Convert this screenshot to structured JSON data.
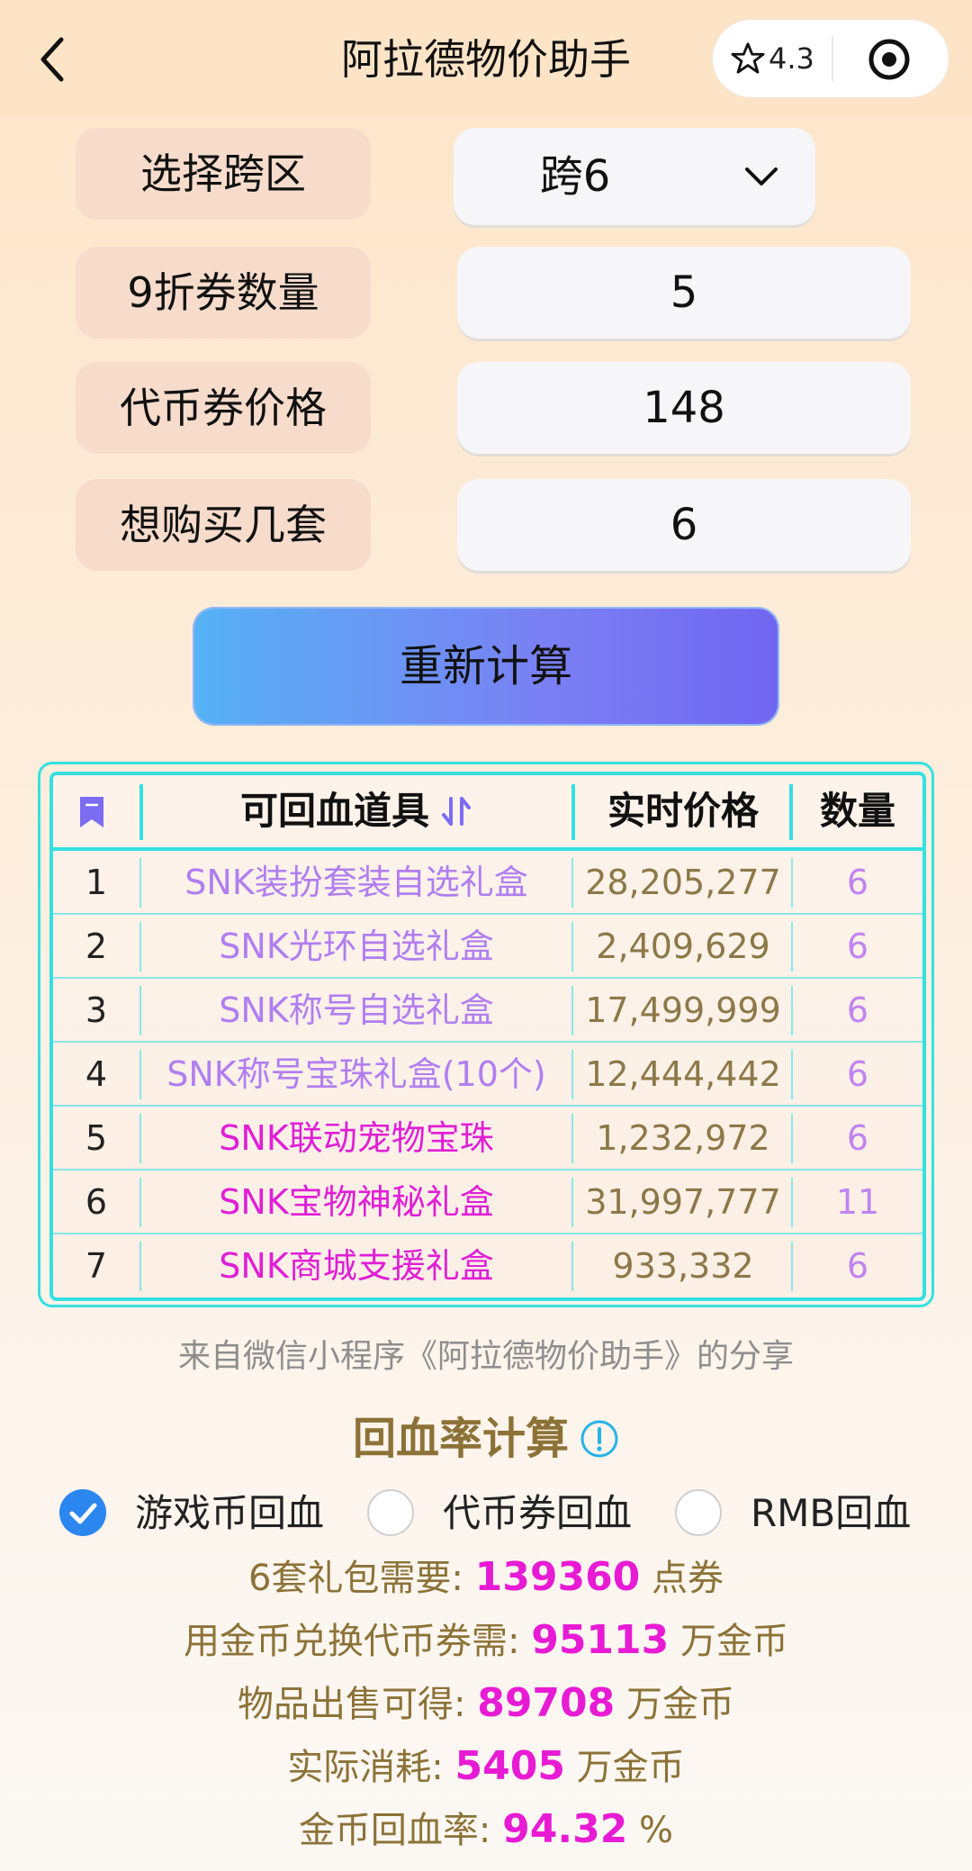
{
  "header": {
    "title": "阿拉德物价助手",
    "rating": "4.3"
  },
  "form": {
    "region_label": "选择跨区",
    "region_value": "跨6",
    "coupon_label": "9折券数量",
    "coupon_value": "5",
    "token_price_label": "代币券价格",
    "token_price_value": "148",
    "sets_label": "想购买几套",
    "sets_value": "6",
    "recalc_button": "重新计算"
  },
  "table": {
    "headers": {
      "item": "可回血道具",
      "price": "实时价格",
      "qty": "数量"
    },
    "rows": [
      {
        "idx": "1",
        "name": "SNK装扮套装自选礼盒",
        "price": "28,205,277",
        "qty": "6",
        "name_color": "#b07ef0"
      },
      {
        "idx": "2",
        "name": "SNK光环自选礼盒",
        "price": "2,409,629",
        "qty": "6",
        "name_color": "#b07ef0"
      },
      {
        "idx": "3",
        "name": "SNK称号自选礼盒",
        "price": "17,499,999",
        "qty": "6",
        "name_color": "#b07ef0"
      },
      {
        "idx": "4",
        "name": "SNK称号宝珠礼盒(10个)",
        "price": "12,444,442",
        "qty": "6",
        "name_color": "#b07ef0"
      },
      {
        "idx": "5",
        "name": "SNK联动宠物宝珠",
        "price": "1,232,972",
        "qty": "6",
        "name_color": "#e01fd6"
      },
      {
        "idx": "6",
        "name": "SNK宝物神秘礼盒",
        "price": "31,997,777",
        "qty": "11",
        "name_color": "#e01fd6"
      },
      {
        "idx": "7",
        "name": "SNK商城支援礼盒",
        "price": "933,332",
        "qty": "6",
        "name_color": "#e01fd6"
      }
    ]
  },
  "share_text": "来自微信小程序《阿拉德物价助手》的分享",
  "section_title": "回血率计算",
  "options": {
    "game_coin": "游戏币回血",
    "token": "代币券回血",
    "rmb": "RMB回血"
  },
  "stats": {
    "s1_prefix": "6套礼包需要: ",
    "s1_value": "139360",
    "s1_suffix": " 点券",
    "s2_prefix": "用金币兑换代币券需: ",
    "s2_value": "95113",
    "s2_suffix": " 万金币",
    "s3_prefix": "物品出售可得: ",
    "s3_value": "89708",
    "s3_suffix": " 万金币",
    "s4_prefix": "实际消耗: ",
    "s4_value": "5405",
    "s4_suffix": " 万金币",
    "s5_prefix": "金币回血率: ",
    "s5_value": "94.32",
    "s5_suffix": " %"
  }
}
